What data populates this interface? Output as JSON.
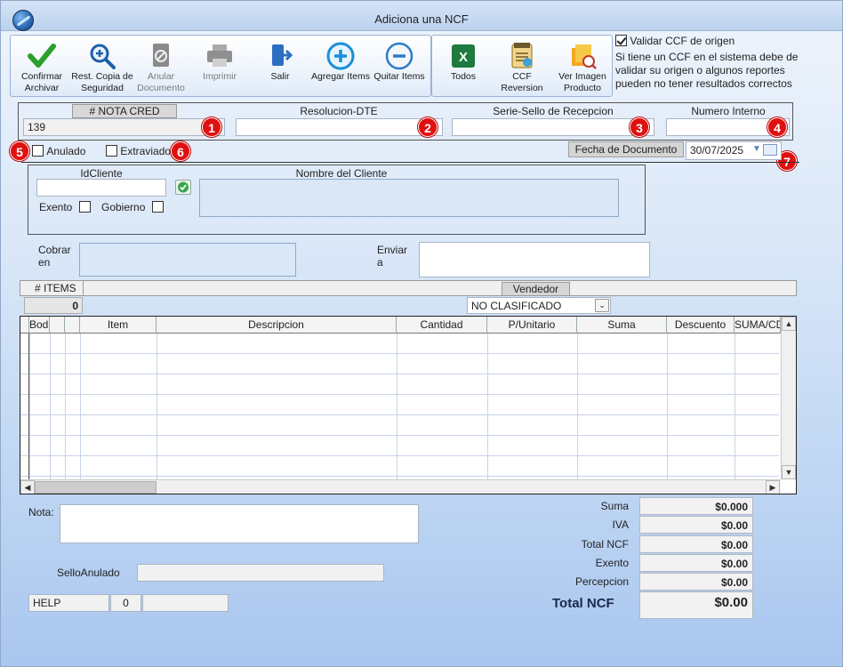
{
  "window": {
    "title": "Adiciona una NCF"
  },
  "toolbar": {
    "buttons": [
      {
        "id": "confirmar",
        "label": "Confirmar Archivar",
        "icon": "check-icon"
      },
      {
        "id": "rest-copia",
        "label": "Rest. Copia de Seguridad",
        "icon": "magnify-plus-icon"
      },
      {
        "id": "anular",
        "label": "Anular Documento",
        "icon": "cancel-document-icon"
      },
      {
        "id": "imprimir",
        "label": "Imprimir",
        "icon": "printer-icon"
      },
      {
        "id": "salir",
        "label": "Salir",
        "icon": "exit-icon"
      },
      {
        "id": "agregar",
        "label": "Agregar Items",
        "icon": "plus-circle-icon"
      },
      {
        "id": "quitar",
        "label": "Quitar Items",
        "icon": "minus-circle-icon"
      }
    ],
    "export_buttons": [
      {
        "id": "todos",
        "label": "Todos",
        "icon": "excel-icon"
      },
      {
        "id": "ccf-reversion",
        "label": "CCF Reversion",
        "icon": "ccf-document-icon"
      },
      {
        "id": "ver-imagen",
        "label": "Ver Imagen Producto",
        "icon": "product-image-icon"
      }
    ]
  },
  "validar": {
    "label": "Validar CCF de origen",
    "checked": true,
    "note": "Si tiene un CCF en el sistema debe de validar su origen o algunos reportes pueden no tener resultados correctos"
  },
  "header": {
    "nota_cred_label": "# NOTA CRED",
    "nota_cred_value": "139",
    "resolucion_label": "Resolucion-DTE",
    "resolucion_value": "",
    "serie_label": "Serie-Sello de Recepcion",
    "serie_value": "",
    "numero_interno_label": "Numero Interno",
    "numero_interno_value": ""
  },
  "badges": [
    "1",
    "2",
    "3",
    "4",
    "5",
    "6",
    "7"
  ],
  "flags": {
    "anulado_label": "Anulado",
    "extraviado_label": "Extraviado",
    "fecha_label": "Fecha de  Documento",
    "fecha_value": "30/07/2025"
  },
  "cliente": {
    "id_label": "IdCliente",
    "id_value": "",
    "nombre_label": "Nombre del Cliente",
    "nombre_value": "",
    "exento_label": "Exento",
    "gobierno_label": "Gobierno"
  },
  "cobrar": {
    "label_line1": "Cobrar",
    "label_line2": "en",
    "value": ""
  },
  "enviar": {
    "label_line1": "Enviar",
    "label_line2": "a",
    "value": ""
  },
  "items_bar": {
    "items_label": "# ITEMS",
    "items_count": "0",
    "vendedor_label": "Vendedor",
    "vendedor_value": "NO CLASIFICADO"
  },
  "grid": {
    "columns": [
      "Bodega",
      "",
      "",
      "Item",
      "Descripcion",
      "Cantidad",
      "P/Unitario",
      "Suma",
      "Descuento",
      "SUMA/CD"
    ]
  },
  "nota": {
    "label": "Nota:",
    "value": ""
  },
  "sello": {
    "label": "SelloAnulado",
    "value": ""
  },
  "help": {
    "label": "HELP",
    "count": "0",
    "extra": ""
  },
  "totals": {
    "suma_label": "Suma",
    "suma_value": "$0.000",
    "iva_label": "IVA",
    "iva_value": "$0.00",
    "total_ncf_label": "Total NCF",
    "total_ncf_value": "$0.00",
    "exento_label": "Exento",
    "exento_value": "$0.00",
    "percepcion_label": "Percepcion",
    "percepcion_value": "$0.00",
    "grand_label": "Total NCF",
    "grand_value": "$0.00"
  }
}
